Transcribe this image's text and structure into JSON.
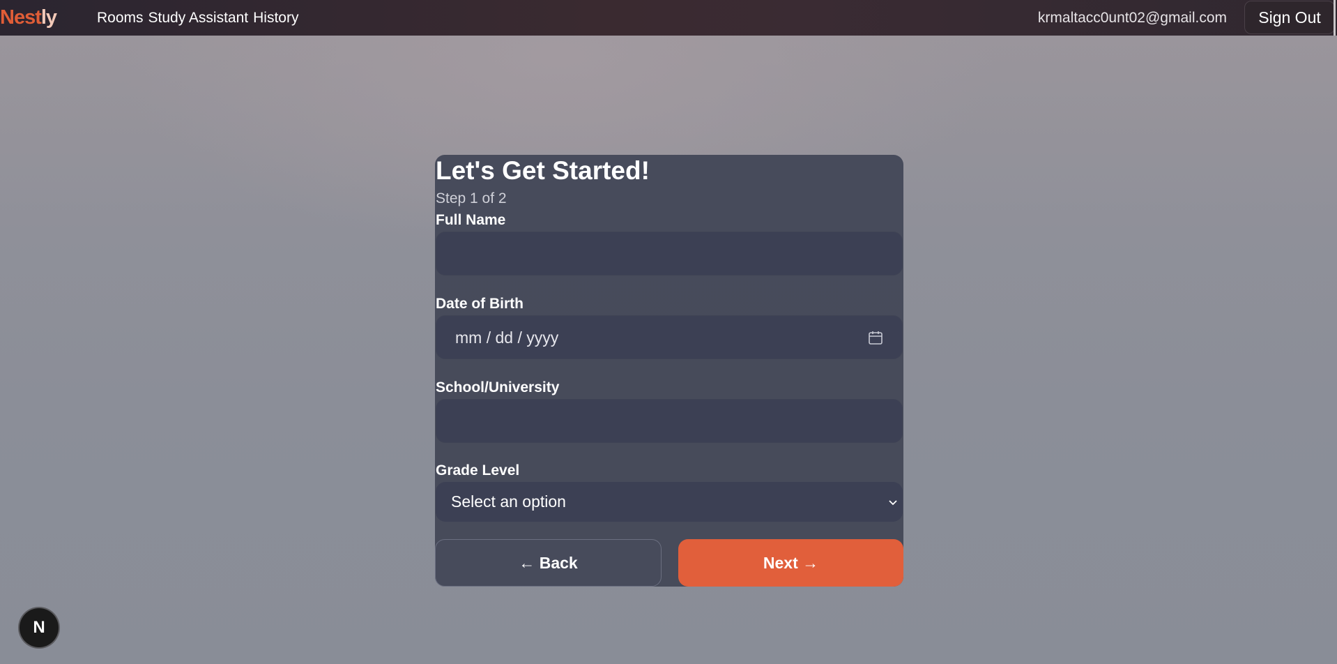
{
  "header": {
    "logo_part1": "Nest",
    "logo_part2": "ly",
    "nav": [
      "Rooms",
      "Study Assistant",
      "History"
    ],
    "user_email": "krmaltacc0unt02@gmail.com",
    "sign_out_label": "Sign Out"
  },
  "form": {
    "title": "Let's Get Started!",
    "step": "Step 1 of 2",
    "full_name": {
      "label": "Full Name",
      "value": ""
    },
    "date_of_birth": {
      "label": "Date of Birth",
      "placeholder": "mm / dd / yyyy"
    },
    "school": {
      "label": "School/University",
      "value": ""
    },
    "grade_level": {
      "label": "Grade Level",
      "selected": "Select an option"
    },
    "back_label": "← Back",
    "next_label": "Next →"
  },
  "dev_badge": {
    "letter": "N"
  },
  "colors": {
    "accent": "#e15f3b",
    "card_bg": "#474b5b",
    "field_bg": "#3c4054",
    "topbar_bg": "#2b2530"
  },
  "icons": {
    "date_picker": "calendar-icon",
    "select": "chevron-down-icon"
  }
}
